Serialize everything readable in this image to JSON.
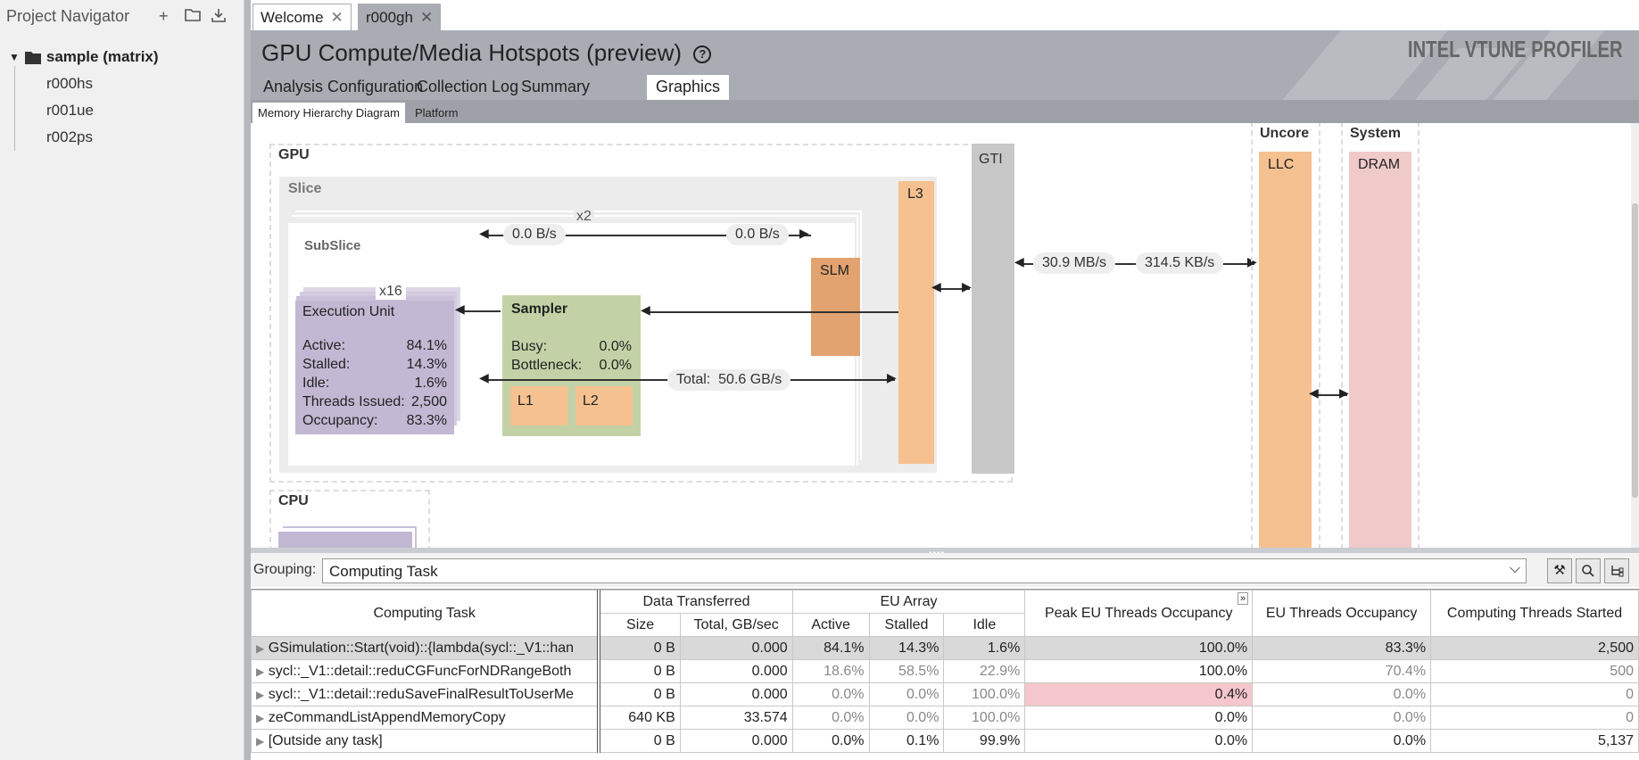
{
  "navigator": {
    "title": "Project Navigator",
    "project": "sample (matrix)",
    "runs": [
      "r000hs",
      "r001ue",
      "r002ps"
    ]
  },
  "tabs": [
    {
      "label": "Welcome"
    },
    {
      "label": "r000gh"
    }
  ],
  "header": {
    "title": "GPU Compute/Media Hotspots (preview)",
    "brand": "INTEL VTUNE PROFILER",
    "view_tabs": [
      "Analysis Configuration",
      "Collection Log",
      "Summary",
      "Graphics"
    ],
    "sub_tabs": [
      "Memory Hierarchy Diagram",
      "Platform"
    ]
  },
  "diagram": {
    "gpu_label": "GPU",
    "slice_label": "Slice",
    "slice_mult": "x2",
    "subslice_label": "SubSlice",
    "eu_mult": "x16",
    "eu": {
      "title": "Execution Unit",
      "rows": [
        {
          "k": "Active:",
          "v": "84.1%"
        },
        {
          "k": "Stalled:",
          "v": "14.3%"
        },
        {
          "k": "Idle:",
          "v": "1.6%"
        },
        {
          "k": "Threads Issued:",
          "v": "2,500"
        },
        {
          "k": "Occupancy:",
          "v": "83.3%"
        }
      ]
    },
    "sampler": {
      "title": "Sampler",
      "busy_k": "Busy:",
      "busy_v": "0.0%",
      "bottleneck_k": "Bottleneck:",
      "bottleneck_v": "0.0%",
      "l1": "L1",
      "l2": "L2"
    },
    "slm": "SLM",
    "l3": "L3",
    "gti": "GTI",
    "uncore": "Uncore",
    "llc": "LLC",
    "system": "System",
    "dram": "DRAM",
    "cpu": "CPU",
    "rate_left": "0.0 B/s",
    "rate_right": "0.0 B/s",
    "total_label": "Total:",
    "total_value": "50.6 GB/s",
    "gti_read": "30.9 MB/s",
    "gti_write": "314.5 KB/s"
  },
  "grouping": {
    "label": "Grouping:",
    "value": "Computing Task"
  },
  "grid": {
    "headers": {
      "task": "Computing Task",
      "data_transferred": "Data Transferred",
      "size": "Size",
      "total": "Total, GB/sec",
      "eu_array": "EU Array",
      "active": "Active",
      "stalled": "Stalled",
      "idle": "Idle",
      "peak": "Peak EU Threads Occupancy",
      "occupancy": "EU Threads Occupancy",
      "threads": "Computing Threads Started"
    },
    "rows": [
      {
        "task": "GSimulation::Start(void)::{lambda(sycl::_V1::han",
        "size": "0 B",
        "total": "0.000",
        "active": "84.1%",
        "stalled": "14.3%",
        "idle": "1.6%",
        "peak": "100.0%",
        "occ": "83.3%",
        "threads": "2,500"
      },
      {
        "task": "sycl::_V1::detail::reduCGFuncForNDRangeBoth",
        "size": "0 B",
        "total": "0.000",
        "active": "18.6%",
        "stalled": "58.5%",
        "idle": "22.9%",
        "peak": "100.0%",
        "occ": "70.4%",
        "threads": "500"
      },
      {
        "task": "sycl::_V1::detail::reduSaveFinalResultToUserMe",
        "size": "0 B",
        "total": "0.000",
        "active": "0.0%",
        "stalled": "0.0%",
        "idle": "100.0%",
        "peak": "0.4%",
        "occ": "0.0%",
        "threads": "0"
      },
      {
        "task": "zeCommandListAppendMemoryCopy",
        "size": "640 KB",
        "total": "33.574",
        "active": "0.0%",
        "stalled": "0.0%",
        "idle": "100.0%",
        "peak": "0.0%",
        "occ": "0.0%",
        "threads": "0"
      },
      {
        "task": "[Outside any task]",
        "size": "0 B",
        "total": "0.000",
        "active": "0.0%",
        "stalled": "0.1%",
        "idle": "99.9%",
        "peak": "0.0%",
        "occ": "0.0%",
        "threads": "5,137"
      }
    ]
  }
}
